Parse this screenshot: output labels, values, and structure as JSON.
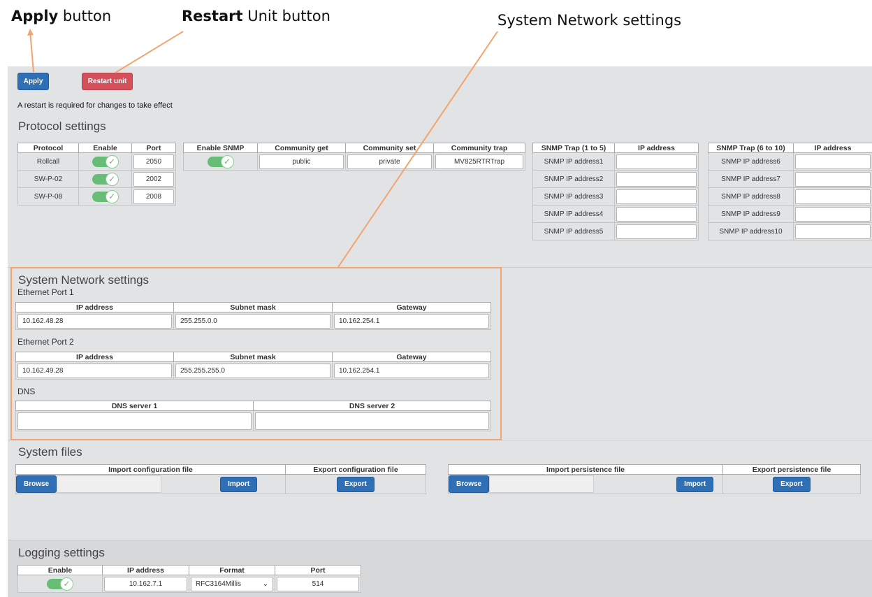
{
  "callouts": {
    "apply": {
      "bold": "Apply",
      "rest": " button"
    },
    "restart": {
      "bold": "Restart",
      "rest": " Unit button"
    },
    "network": "System Network settings"
  },
  "toolbar": {
    "apply_label": "Apply",
    "restart_label": "Restart unit",
    "restart_note": "A restart is required for changes to take effect"
  },
  "protocol": {
    "title": "Protocol settings",
    "headers": {
      "protocol": "Protocol",
      "enable": "Enable",
      "port": "Port"
    },
    "rows": [
      {
        "name": "Rollcall",
        "port": "2050"
      },
      {
        "name": "SW-P-02",
        "port": "2002"
      },
      {
        "name": "SW-P-08",
        "port": "2008"
      }
    ],
    "snmp_headers": {
      "enable": "Enable SNMP",
      "get": "Community get",
      "set": "Community set",
      "trap": "Community trap"
    },
    "snmp_values": {
      "get": "public",
      "set": "private",
      "trap": "MV825RTRTrap"
    },
    "trap1_headers": {
      "name": "SNMP Trap (1 to 5)",
      "ip": "IP address"
    },
    "trap1": [
      "SNMP IP address1",
      "SNMP IP address2",
      "SNMP IP address3",
      "SNMP IP address4",
      "SNMP IP address5"
    ],
    "trap2_headers": {
      "name": "SNMP Trap (6 to 10)",
      "ip": "IP address"
    },
    "trap2": [
      "SNMP IP address6",
      "SNMP IP address7",
      "SNMP IP address8",
      "SNMP IP address9",
      "SNMP IP address10"
    ]
  },
  "network": {
    "title": "System Network settings",
    "headers": {
      "ip": "IP address",
      "mask": "Subnet mask",
      "gw": "Gateway"
    },
    "port1": {
      "label": "Ethernet Port 1",
      "ip": "10.162.48.28",
      "mask": "255.255.0.0",
      "gw": "10.162.254.1"
    },
    "port2": {
      "label": "Ethernet Port 2",
      "ip": "10.162.49.28",
      "mask": "255.255.255.0",
      "gw": "10.162.254.1"
    },
    "dns": {
      "label": "DNS",
      "server1_header": "DNS server 1",
      "server2_header": "DNS server 2",
      "server1": "",
      "server2": ""
    }
  },
  "files": {
    "title": "System files",
    "import_config_header": "Import configuration file",
    "export_config_header": "Export configuration file",
    "import_persist_header": "Import persistence file",
    "export_persist_header": "Export persistence file",
    "browse_label": "Browse",
    "import_label": "Import",
    "export_label": "Export"
  },
  "logging": {
    "title": "Logging settings",
    "headers": {
      "enable": "Enable",
      "ip": "IP address",
      "format": "Format",
      "port": "Port"
    },
    "ip": "10.162.7.1",
    "format": "RFC3164Millis",
    "port": "514"
  },
  "colors": {
    "accent_blue": "#2e6fb5",
    "restart_red": "#d4515c",
    "toggle_green": "#68bd76",
    "callout_orange": "#f3a46e"
  }
}
